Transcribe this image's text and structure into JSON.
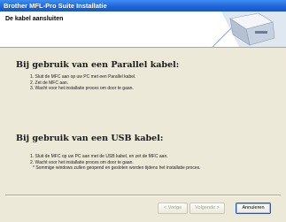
{
  "window": {
    "title": "Brother MFL-Pro Suite Installatie"
  },
  "header": {
    "title": "De kabel aansluiten",
    "graphic_icon": "brother-printer-graphic"
  },
  "parallel": {
    "heading": "Bij gebruik van een Parallel kabel:",
    "steps": [
      "1. Sluit de MFC aan op uw PC met een Parallel kabel.",
      "2. Zet de MFC aan.",
      "3. Wacht voor het installatie proces om door te gaan."
    ]
  },
  "usb": {
    "heading": "Bij gebruik van een USB kabel:",
    "steps": [
      "1. Sluit de MFC op uw PC aan met de USB kabel, en zet de MFC aan.",
      "2. Wacht voor het installatie proces om door te gaan.",
      "* Sommige windows zullen geopend en gesloten worden tijdens het installatie proces."
    ]
  },
  "buttons": {
    "back": "< Vorige",
    "next": "Volgende >",
    "cancel": "Annuleren"
  },
  "colors": {
    "titlebar": "#1f63d6",
    "dialog_bg": "#ece9d8",
    "header_bg": "#ffffff"
  }
}
